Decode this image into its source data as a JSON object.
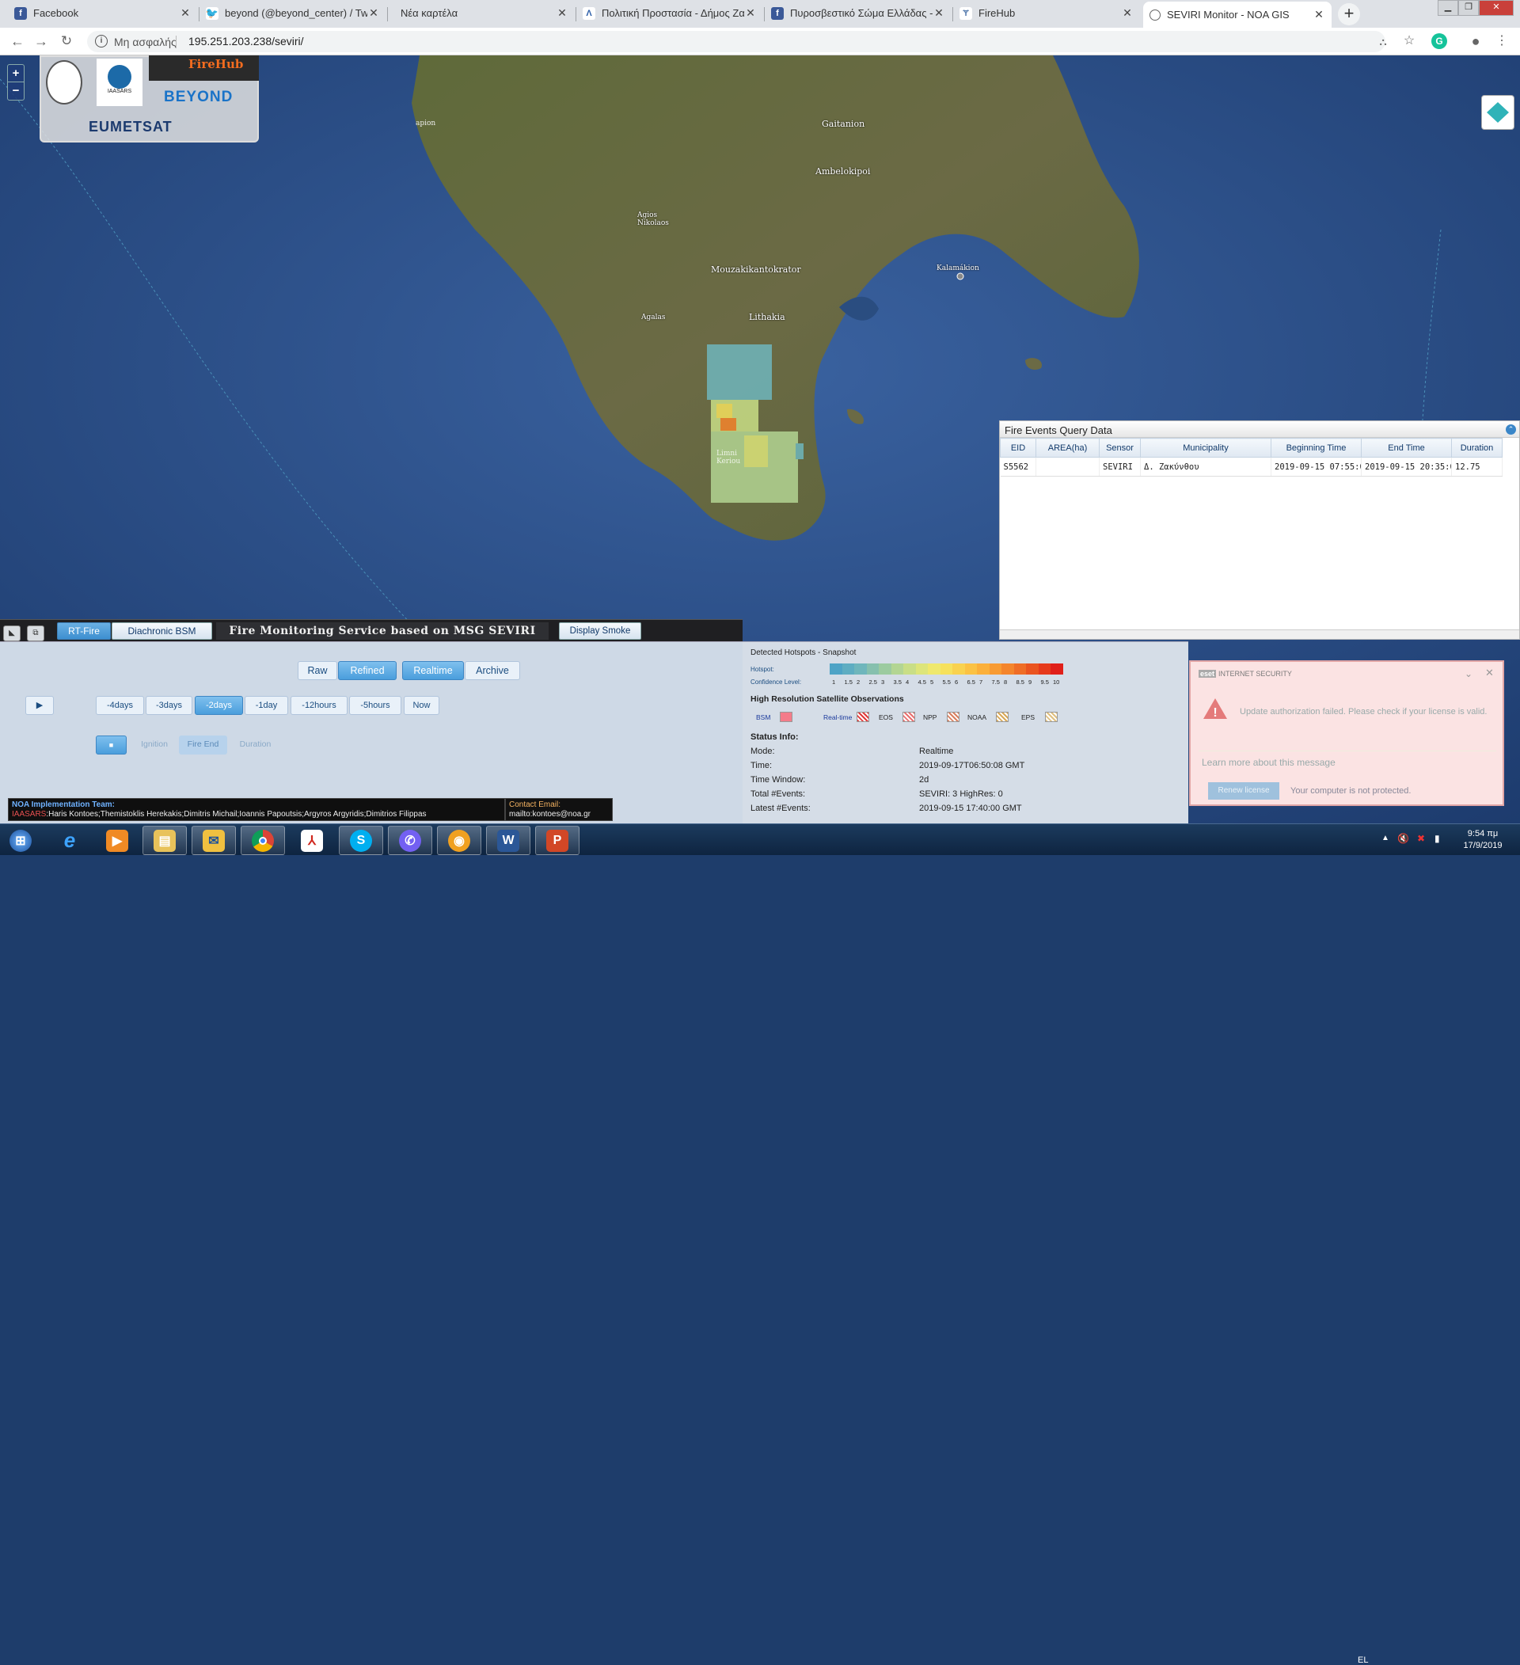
{
  "browser": {
    "tabs": [
      {
        "title": "Facebook",
        "icon": "facebook-icon",
        "color": "#3b5998"
      },
      {
        "title": "beyond (@beyond_center) / Twit",
        "icon": "twitter-icon",
        "color": "#1da1f2"
      },
      {
        "title": "Νέα καρτέλα",
        "icon": "",
        "color": ""
      },
      {
        "title": "Πολιτική Προστασία - Δήμος Ζα",
        "icon": "civil-protection-icon",
        "color": "#2d5fa8"
      },
      {
        "title": "Πυροσβεστικό Σώμα Ελλάδας - I",
        "icon": "facebook-icon",
        "color": "#3b5998"
      },
      {
        "title": "FireHub",
        "icon": "firehub-icon",
        "color": "#5b7fb0"
      },
      {
        "title": "SEVIRI Monitor - NOA GIS",
        "icon": "globe-icon",
        "color": "#666"
      }
    ],
    "address": {
      "security": "Μη ασφαλής",
      "url": "195.251.203.238/seviri/"
    }
  },
  "map": {
    "places": [
      {
        "name": "Gaitanion"
      },
      {
        "name": "Ambelokipoi"
      },
      {
        "name": "Agios Nikolaos"
      },
      {
        "name": "Mouzakikantokrator"
      },
      {
        "name": "Kalamákion"
      },
      {
        "name": "Agalas"
      },
      {
        "name": "Lithakia"
      },
      {
        "name": "Limni Keriou"
      }
    ],
    "logos": {
      "firehub": "FireHub",
      "beyond": "BEYOND",
      "eumetsat": "EUMETSAT",
      "iaasars": "IAASARS"
    },
    "zoom": {
      "in": "+",
      "out": "−"
    }
  },
  "events_panel": {
    "title": "Fire Events Query Data",
    "columns": [
      "EID",
      "AREA(ha)",
      "Sensor",
      "Municipality",
      "Beginning Time",
      "End Time",
      "Duration"
    ],
    "rows": [
      [
        "S5562",
        "",
        "SEVIRI",
        "Δ. Ζακύνθου",
        "2019-09-15 07:55:0",
        "2019-09-15 20:35:0",
        "12.75"
      ]
    ]
  },
  "toolbar": {
    "tabs": [
      "RT-Fire",
      "Diachronic BSM"
    ],
    "title": "Fire Monitoring Service based on MSG SEVIRI",
    "smoke": "Display Smoke"
  },
  "controls": {
    "mode_buttons": [
      "Raw",
      "Refined"
    ],
    "source_buttons": [
      "Realtime",
      "Archive"
    ],
    "play": "▶",
    "time_buttons": [
      "-4days",
      "-3days",
      "-2days",
      "-1day",
      "-12hours",
      "-5hours",
      "Now"
    ],
    "stop": "■",
    "display_buttons": [
      "Ignition",
      "Fire End",
      "Duration"
    ]
  },
  "team": {
    "heading": "NOA Implementation Team:",
    "org": "IAASARS",
    "names": ":Haris Kontoes;Themistoklis Herekakis;Dimitris Michail;Ioannis Papoutsis;Argyros Argyridis;Dimitrios Filippas",
    "contact_label": "Contact Email:",
    "contact_value": "mailto:kontoes@noa.gr"
  },
  "status": {
    "hotspots_title": "Detected Hotspots - Snapshot",
    "hotspot_label": "Hotspot:",
    "confidence_label": "Confidence Level:",
    "confidence_levels": [
      "1",
      "1.5",
      "2",
      "2.5",
      "3",
      "3.5",
      "4",
      "4.5",
      "5",
      "5.5",
      "6",
      "6.5",
      "7",
      "7.5",
      "8",
      "8.5",
      "9",
      "9.5",
      "10"
    ],
    "confidence_colors": [
      "#4ea3c6",
      "#5eadc2",
      "#6fb6bc",
      "#86c0ae",
      "#9ccba0",
      "#b3d593",
      "#c9de86",
      "#dde57a",
      "#efe86d",
      "#f6e15d",
      "#f9d24f",
      "#fbc244",
      "#fbb03b",
      "#f89b33",
      "#f4852c",
      "#ef6d26",
      "#ea5420",
      "#e63a1c",
      "#e01f19"
    ],
    "hires_title": "High Resolution Satellite Observations",
    "hires_legend": [
      {
        "label": "BSM",
        "color": "#f47c8a"
      },
      {
        "label": "Real-time",
        "color": "#e03a3a"
      },
      {
        "label": "EOS",
        "color": "#e87070"
      },
      {
        "label": "NPP",
        "color": "#d98060"
      },
      {
        "label": "NOAA",
        "color": "#d8a858"
      },
      {
        "label": "EPS",
        "color": "#e0c080"
      }
    ],
    "info_title": "Status Info:",
    "info": [
      {
        "k": "Mode:",
        "v": "Realtime"
      },
      {
        "k": "Time:",
        "v": "2019-09-17T06:50:08 GMT"
      },
      {
        "k": "Time Window:",
        "v": "2d"
      },
      {
        "k": "Total #Events:",
        "v": "SEVIRI: 3  HighRes: 0"
      },
      {
        "k": "Latest #Events:",
        "v": "2019-09-15 17:40:00 GMT"
      }
    ]
  },
  "eset": {
    "brand": "INTERNET SECURITY",
    "message": "Update authorization failed. Please check if your license is valid.",
    "learn": "Learn more about this message",
    "renew": "Renew license",
    "not_protected": "Your computer is not protected."
  },
  "taskbar": {
    "lang": "EL",
    "time": "9:54 πμ",
    "date": "17/9/2019",
    "apps": [
      "start-orb",
      "internet-explorer",
      "media-player",
      "file-explorer",
      "outlook",
      "chrome",
      "acrobat",
      "skype",
      "viber",
      "vpn",
      "word",
      "presentation"
    ]
  }
}
